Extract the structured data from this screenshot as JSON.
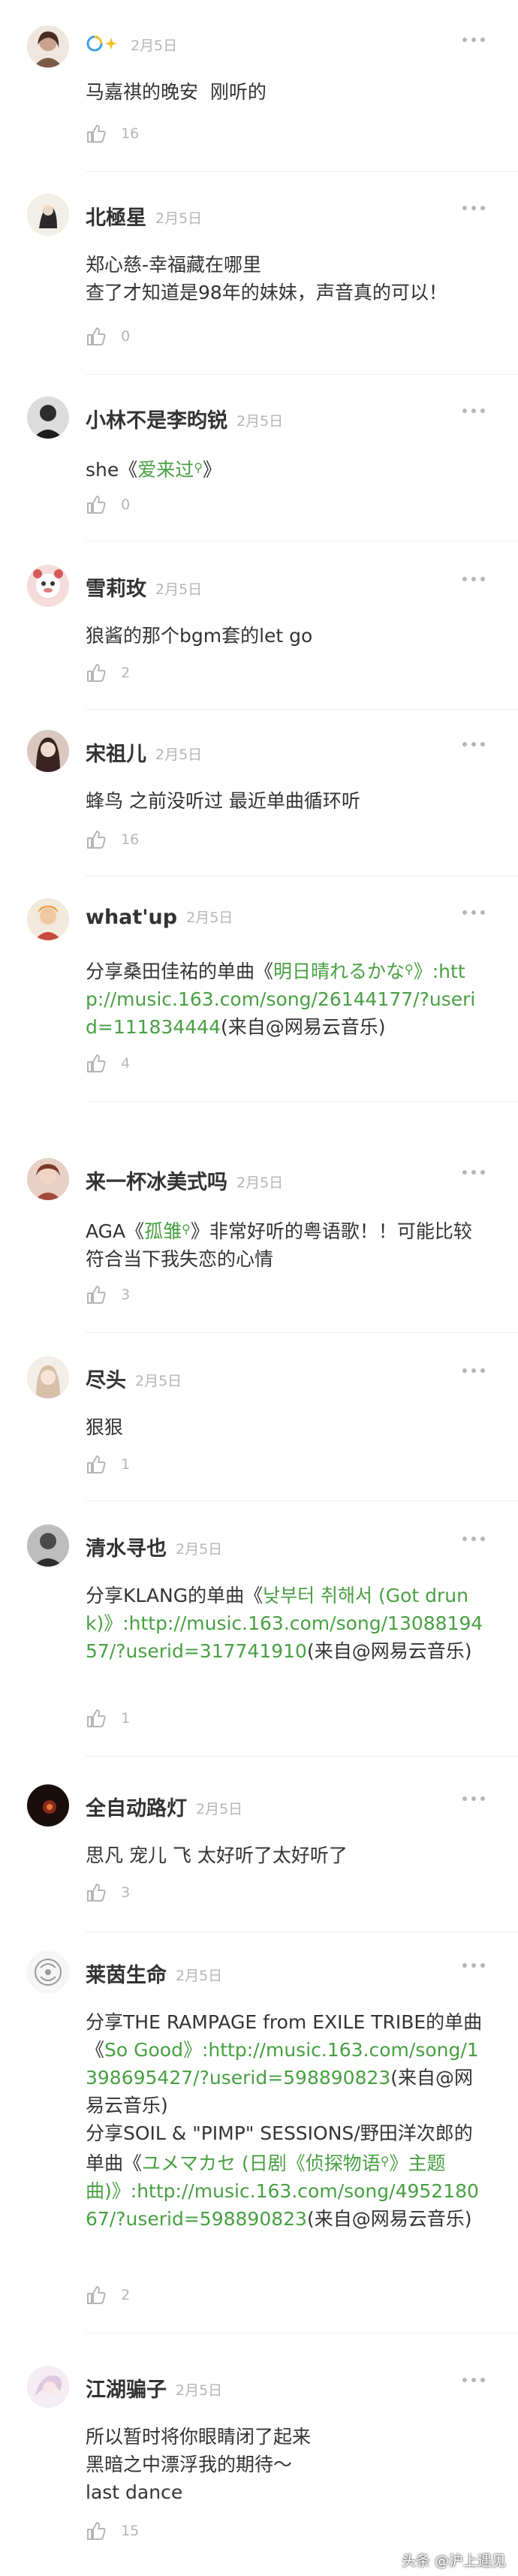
{
  "comments": [
    {
      "name": "",
      "date": "2月5日",
      "badge": "vip-swirl-icon",
      "text": "马嘉祺的晚安  刚听的",
      "likes": "16",
      "avatar_color": "#c9a48c"
    },
    {
      "name": "北極星",
      "date": "2月5日",
      "text": "郑心慈-幸福藏在哪里\n查了才知道是98年的妹妹，声音真的可以！",
      "likes": "0",
      "avatar_color": "#e8e4dc"
    },
    {
      "name": "小林不是李昀锐",
      "date": "2月5日",
      "text_parts": [
        "she《",
        "爱来过",
        "》"
      ],
      "likes": "0",
      "avatar_color": "#3a3a3a"
    },
    {
      "name": "雪莉玫",
      "date": "2月5日",
      "text": "狼酱的那个bgm套的let go",
      "likes": "2",
      "avatar_color": "#d0807a"
    },
    {
      "name": "宋祖儿",
      "date": "2月5日",
      "text": "蜂鸟 之前没听过 最近单曲循环听",
      "likes": "16",
      "avatar_color": "#6a4a44"
    },
    {
      "name": "what'up",
      "date": "2月5日",
      "text_parts": [
        "分享桑田佳祐的单曲《",
        "明日晴れるかな",
        "》:http://music.163.com/song/26144177/?userid=111834444",
        "(来自@网易云音乐)"
      ],
      "likes": "4",
      "avatar_color": "#d8b08c"
    },
    {
      "name": "来一杯冰美式吗",
      "date": "2月5日",
      "text_parts": [
        "AGA《",
        "孤雏",
        "》非常好听的粤语歌！！可能比较符合当下我失恋的心情"
      ],
      "likes": "3",
      "avatar_color": "#a36a58"
    },
    {
      "name": "尽头",
      "date": "2月5日",
      "text": "狠狠",
      "likes": "1",
      "avatar_color": "#e4d8cc"
    },
    {
      "name": "清水寻也",
      "date": "2月5日",
      "text_parts": [
        "分享KLANG的单曲《",
        "낮부터 취해서 (Got drunk)",
        "》:http://music.163.com/song/1308819457/?userid=317741910",
        "(来自@网易云音乐)"
      ],
      "likes": "1",
      "avatar_color": "#5a5a5a"
    },
    {
      "name": "全自动路灯",
      "date": "2月5日",
      "text": "思凡 宠儿 飞 太好听了太好听了",
      "likes": "3",
      "avatar_color": "#2a1a1a"
    },
    {
      "name": "莱茵生命",
      "date": "2月5日",
      "text_parts": [
        "分享THE RAMPAGE from EXILE TRIBE的单曲《",
        "So Good",
        "》:http://music.163.com/song/1398695427/?userid=598890823",
        "(来自@网易云音乐)\n分享SOIL & \"PIMP\" SESSIONS/野田洋次郎的单曲《",
        "ユメマカセ (日剧《侦探物语",
        "》主题曲)",
        "》:http://music.163.com/song/495218067/?userid=598890823",
        "(来自@网易云音乐)"
      ],
      "likes": "2",
      "avatar_color": "#f0f0f0"
    },
    {
      "name": "江湖骗子",
      "date": "2月5日",
      "text": "所以暂时将你眼睛闭了起来\n黑暗之中漂浮我的期待～\nlast dance",
      "likes": "15",
      "avatar_color": "#e8dce8"
    }
  ],
  "watermark": "头条 @沪上遇见",
  "colors": {
    "link": "#48a042",
    "meta": "#b5b5b5",
    "text": "#333333"
  }
}
